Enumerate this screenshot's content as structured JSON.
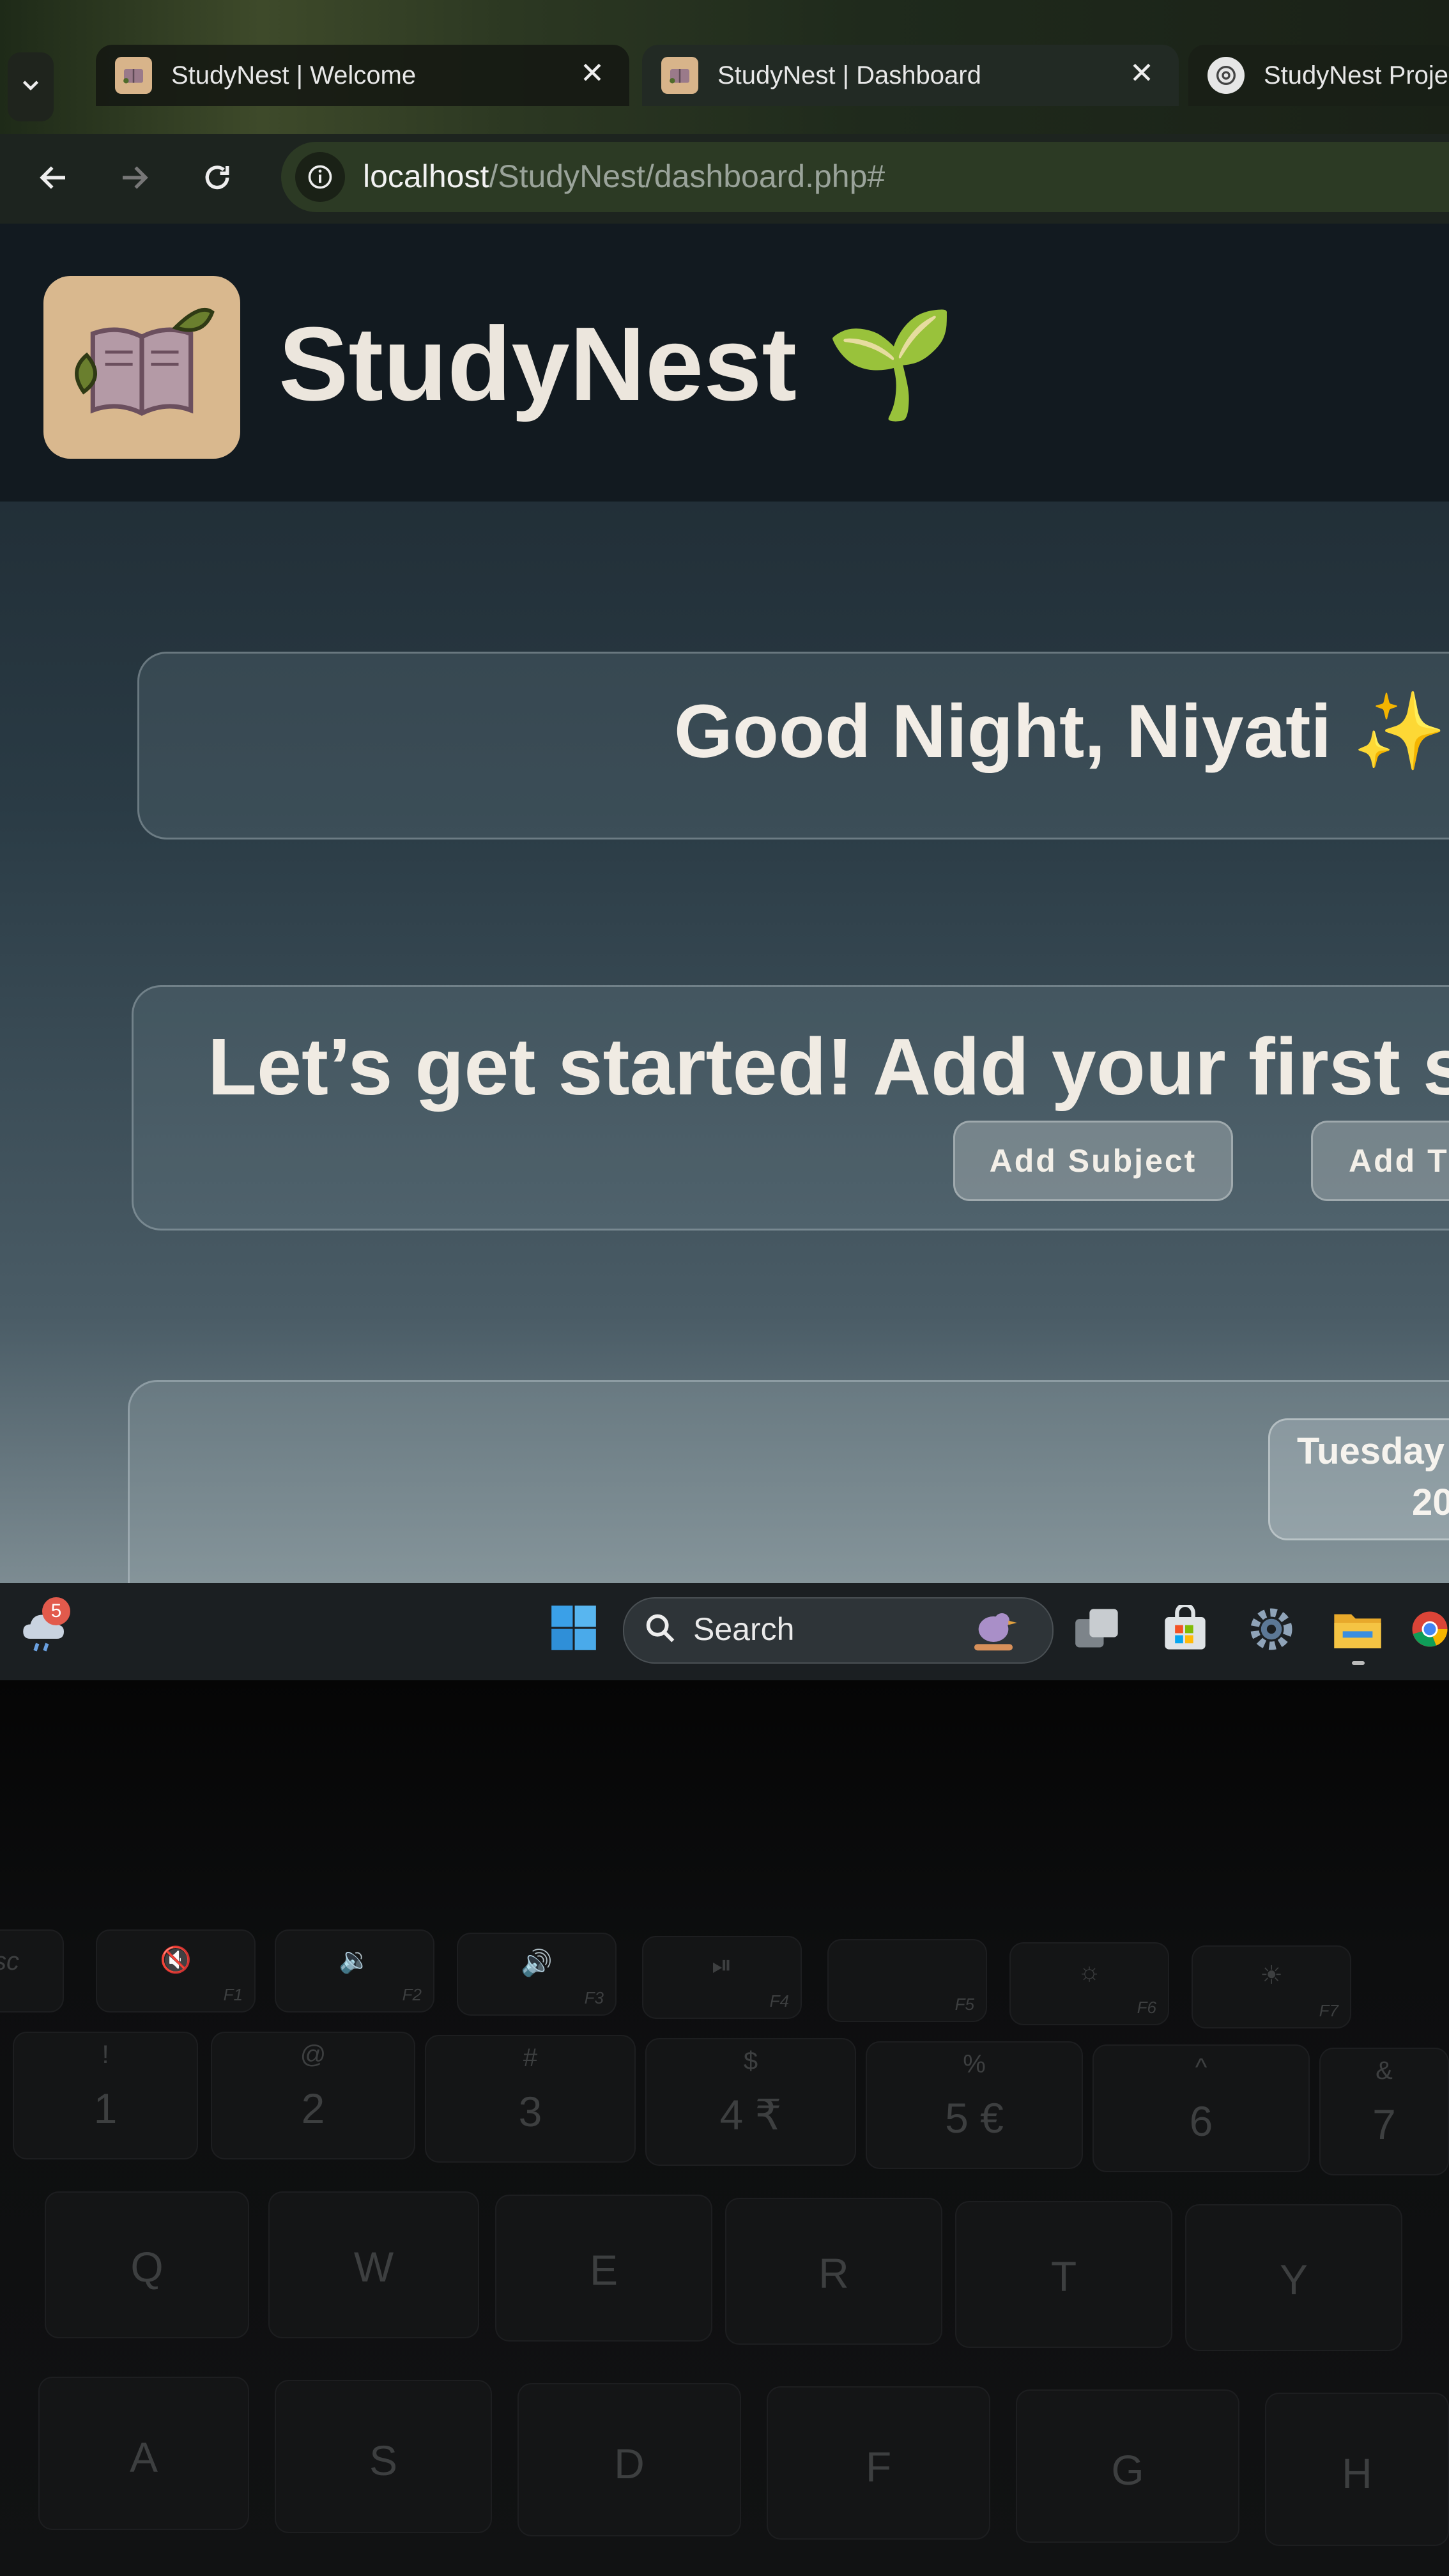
{
  "browser": {
    "tabs": [
      {
        "title": "StudyNest | Welcome",
        "active": false
      },
      {
        "title": "StudyNest | Dashboard",
        "active": true
      },
      {
        "title": "StudyNest Proje",
        "active": false
      }
    ],
    "url_host": "localhost",
    "url_path": "/StudyNest/dashboard.php#"
  },
  "header": {
    "brand": "StudyNest",
    "brand_emoji": "🌱"
  },
  "main": {
    "greeting": "Good Night, Niyati",
    "greeting_emoji": "✨",
    "empty_prompt": "Let’s get started! Add your first s",
    "add_subject_label": "Add Subject",
    "add_task_label": "Add T",
    "date_day": "Tuesday",
    "date_year": "20"
  },
  "taskbar": {
    "weather_badge": "5",
    "search_label": "Search",
    "icons": [
      "start-icon",
      "task-view-icon",
      "store-icon",
      "settings-icon",
      "file-explorer-icon",
      "chrome-icon"
    ]
  },
  "keyboard": {
    "fn_row": [
      {
        "label": "sc",
        "fn": ""
      },
      {
        "label": "🔇",
        "fn": "F1"
      },
      {
        "label": "🔉",
        "fn": "F2"
      },
      {
        "label": "🔊",
        "fn": "F3"
      },
      {
        "label": "⏯",
        "fn": "F4"
      },
      {
        "label": "",
        "fn": "F5"
      },
      {
        "label": "☼",
        "fn": "F6"
      },
      {
        "label": "☀",
        "fn": "F7"
      }
    ],
    "number_row": [
      {
        "top": "!",
        "main": "1"
      },
      {
        "top": "@",
        "main": "2"
      },
      {
        "top": "#",
        "main": "3"
      },
      {
        "top": "$",
        "main": "4 ₹"
      },
      {
        "top": "%",
        "main": "5 €"
      },
      {
        "top": "^",
        "main": "6"
      },
      {
        "top": "&",
        "main": "7"
      }
    ],
    "qwerty_row": [
      "Q",
      "W",
      "E",
      "R",
      "T",
      "Y"
    ],
    "home_row": [
      "A",
      "S",
      "D",
      "F",
      "G",
      "H"
    ]
  },
  "colors": {
    "page_bg": "#2a3b45",
    "text_light": "#f2ede6",
    "logo_bg": "#d9b88e",
    "omnibox_bg": "#2c3a24"
  }
}
